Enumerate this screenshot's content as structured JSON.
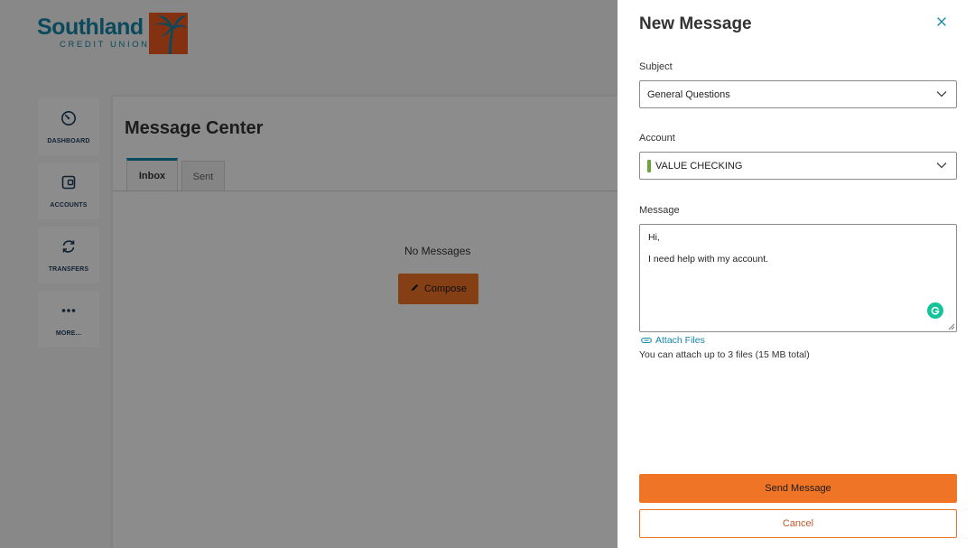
{
  "brand": {
    "name": "Southland",
    "tagline": "CREDIT UNION",
    "primary_color": "#1486a8",
    "accent_color": "#f05a22"
  },
  "sidenav": {
    "items": [
      {
        "label": "DASHBOARD",
        "icon": "gauge-icon"
      },
      {
        "label": "ACCOUNTS",
        "icon": "wallet-icon"
      },
      {
        "label": "TRANSFERS",
        "icon": "transfer-arrows-icon"
      },
      {
        "label": "MORE...",
        "icon": "ellipsis-icon"
      }
    ]
  },
  "message_center": {
    "title": "Message Center",
    "tabs": [
      {
        "label": "Inbox",
        "active": true
      },
      {
        "label": "Sent",
        "active": false
      }
    ],
    "empty_text": "No Messages",
    "compose_label": "Compose"
  },
  "drawer": {
    "title": "New Message",
    "subject_label": "Subject",
    "subject_value": "General Questions",
    "account_label": "Account",
    "account_value": "VALUE CHECKING",
    "account_color": "#6ba539",
    "message_label": "Message",
    "message_line1": "Hi,",
    "message_line2": "I need help with my account.",
    "attach_label": "Attach Files",
    "attach_hint": "You can attach up to 3 files (15 MB total)",
    "send_label": "Send Message",
    "cancel_label": "Cancel",
    "button_color": "#f07426"
  }
}
